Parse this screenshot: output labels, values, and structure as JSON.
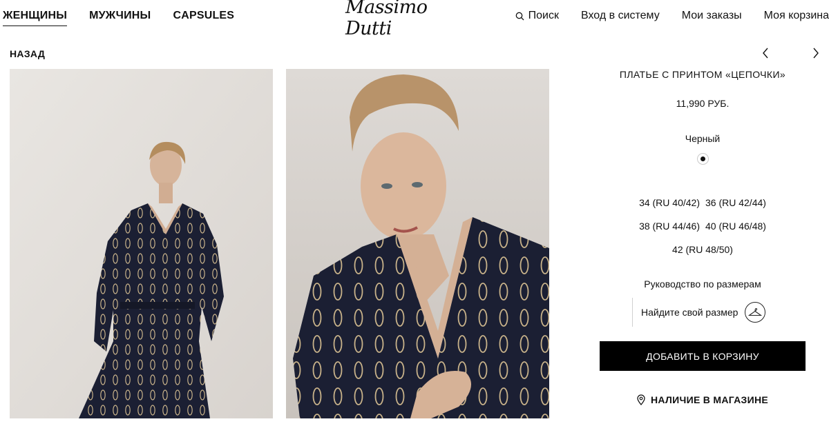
{
  "header": {
    "nav_left": [
      "ЖЕНЩИНЫ",
      "МУЖЧИНЫ",
      "CAPSULES"
    ],
    "logo": "Massimo Dutti",
    "search_label": "Поиск",
    "login_label": "Вход в систему",
    "orders_label": "Мои заказы",
    "cart_label": "Моя корзина"
  },
  "back_label": "НАЗАД",
  "icons": [
    "search-icon",
    "chevron-left-icon",
    "chevron-right-icon",
    "hanger-icon",
    "location-pin-icon"
  ],
  "product": {
    "title": "ПЛАТЬЕ С ПРИНТОМ «ЦЕПОЧКИ»",
    "price": "11,990 РУБ.",
    "color_name": "Черный",
    "sizes": [
      "34 (RU 40/42)",
      "36 (RU 42/44)",
      "38 (RU 44/46)",
      "40 (RU 46/48)",
      "42 (RU 48/50)"
    ],
    "size_guide_label": "Руководство по размерам",
    "find_size_label": "Найдите свой размер",
    "add_to_cart_label": "ДОБАВИТЬ В КОРЗИНУ",
    "store_availability_label": "НАЛИЧИЕ В МАГАЗИНЕ"
  },
  "colors": {
    "button_bg": "#000000",
    "dress": "#1b1f33",
    "chain_print": "#c9b38a",
    "photo_bg": "#e6e2de"
  }
}
